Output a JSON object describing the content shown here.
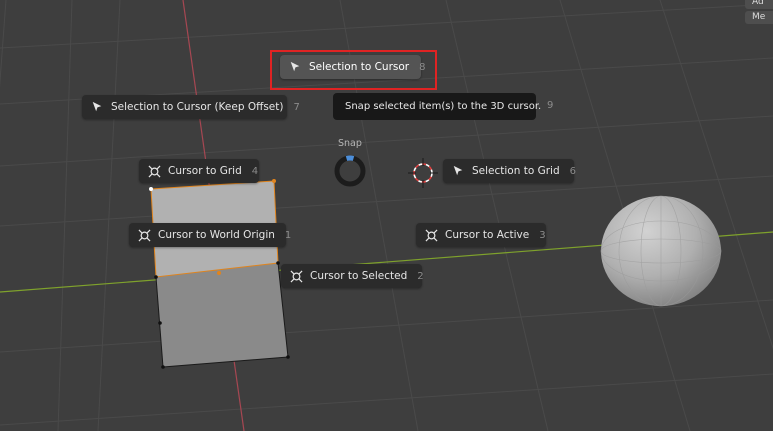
{
  "header_buttons": {
    "top": "Ad",
    "second": "Me"
  },
  "pie_menu": {
    "title": "Snap",
    "items": [
      {
        "label": "Selection to Cursor",
        "number": "8",
        "icon": "cursor-arrow-icon",
        "highlighted": true
      },
      {
        "label": "Selection to Cursor (Keep Offset)",
        "number": "7",
        "icon": "cursor-arrow-icon"
      },
      {
        "label": "Cursor to Grid",
        "number": "4",
        "icon": "cursor-snap-icon"
      },
      {
        "label": "Selection to Grid",
        "number": "6",
        "icon": "cursor-arrow-icon"
      },
      {
        "label": "Cursor to World Origin",
        "number": "1",
        "icon": "cursor-snap-icon"
      },
      {
        "label": "Cursor to Active",
        "number": "3",
        "icon": "cursor-snap-icon"
      },
      {
        "label": "Cursor to Selected",
        "number": "2",
        "icon": "cursor-snap-icon"
      }
    ],
    "tooltip": {
      "text": "Snap selected item(s) to the 3D cursor.",
      "number": "9"
    }
  },
  "colors": {
    "viewport_background": "#3e3e3e",
    "grid_line": "#4a4a4a",
    "x_axis": "#a64752",
    "y_axis": "#7fa22c",
    "menu_item_background": "#2b2b2b",
    "menu_item_active": "#545454",
    "highlight_border": "#e02323",
    "snap_ring_accent": "#4c8ed9",
    "selection_outline": "#e0841d"
  }
}
